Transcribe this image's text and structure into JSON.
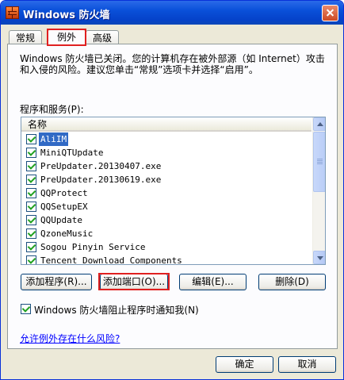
{
  "window": {
    "title": "Windows 防火墙"
  },
  "tabs": [
    {
      "label": "常规"
    },
    {
      "label": "例外"
    },
    {
      "label": "高级"
    }
  ],
  "description": "Windows 防火墙已关闭。您的计算机存在被外部源（如 Internet）攻击和入侵的风险。建议您单击“常规”选项卡并选择“启用”。",
  "programs": {
    "label": "程序和服务(P):",
    "column_header": "名称",
    "selected_index": 0,
    "items": [
      {
        "name": "AliIM",
        "checked": true
      },
      {
        "name": "MiniQTUpdate",
        "checked": true
      },
      {
        "name": "PreUpdater.20130407.exe",
        "checked": true
      },
      {
        "name": "PreUpdater.20130619.exe",
        "checked": true
      },
      {
        "name": "QQProtect",
        "checked": true
      },
      {
        "name": "QQSetupEX",
        "checked": true
      },
      {
        "name": "QQUpdate",
        "checked": true
      },
      {
        "name": "QzoneMusic",
        "checked": true
      },
      {
        "name": "Sogou Pinyin Service",
        "checked": true
      },
      {
        "name": "Tencent Download Components",
        "checked": true
      }
    ]
  },
  "buttons": {
    "add_program": "添加程序(R)...",
    "add_port": "添加端口(O)...",
    "edit": "编辑(E)...",
    "delete": "删除(D)"
  },
  "notify": {
    "label": "Windows 防火墙阻止程序时通知我(N)",
    "checked": true
  },
  "risk_link": "允许例外存在什么风险?",
  "dialog": {
    "ok": "确定",
    "cancel": "取消"
  },
  "colors": {
    "titlebar": "#0a50d9",
    "selection": "#316ac5",
    "highlight": "#e02020",
    "link": "#0000ff"
  }
}
